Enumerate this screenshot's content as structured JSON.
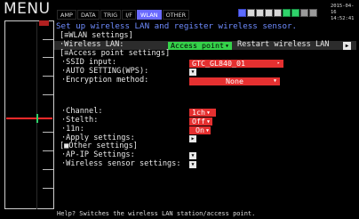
{
  "app": {
    "brand": "MENU"
  },
  "tabs": [
    "AMP",
    "DATA",
    "TRIG",
    "I/F",
    "WLAN",
    "OTHER"
  ],
  "datetime": {
    "date": "2015-04-16",
    "time": "14:52:41"
  },
  "title": "Set up wireless LAN and register wireless sensor.",
  "wlan_settings": {
    "header": "[≡WLAN settings]",
    "wireless_lan_label": "·Wireless LAN:",
    "wireless_lan_value": "Access point",
    "restart_label": "Restart wireless LAN"
  },
  "access_point": {
    "header": "[≡Access point settings]",
    "ssid_label": "·SSID input:",
    "ssid_value": "GTC_GL840_01",
    "auto_label": "·AUTO SETTING(WPS):",
    "encryption_label": "·Encryption method:",
    "encryption_value": "None",
    "channel_label": "·Channel:",
    "channel_value": "1ch",
    "stelth_label": "·Stelth:",
    "stelth_value": "Off",
    "n11_label": "·11n:",
    "n11_value": "On",
    "apply_label": "·Apply settings:"
  },
  "other_settings": {
    "header": "[■Other settings]",
    "ap_ip_label": "·AP-IP Settings:",
    "sensor_label": "·Wireless sensor settings:"
  },
  "help": "Help?  Switches the wireless LAN station/access point.",
  "colors": {
    "accent_tab": "#6a6aff",
    "selected": "#35d24a",
    "dropdown": "#e53030",
    "trace": "#ff2a2a"
  },
  "icons": {
    "caret": "▼",
    "play": "▶"
  }
}
